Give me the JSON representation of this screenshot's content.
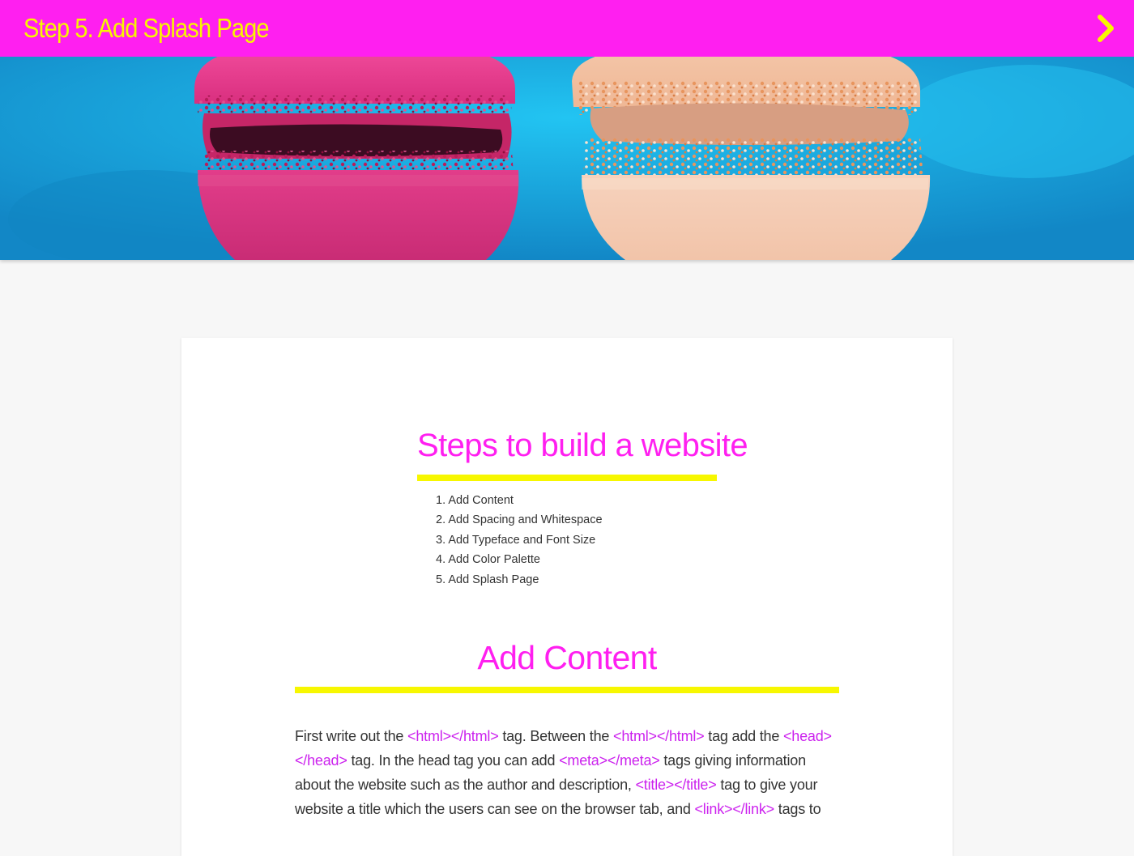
{
  "header": {
    "title": "Step 5. Add Splash Page",
    "next_icon": "chevron-right-icon",
    "colors": {
      "bar": "#ff1ff0",
      "title": "#f7f700"
    }
  },
  "hero": {
    "image": "two macarons (pink and cream) against a blue background"
  },
  "steps": {
    "heading": "Steps to build a website",
    "items": [
      {
        "num": "1.",
        "label": "Add Content"
      },
      {
        "num": "2.",
        "label": "Add Spacing and Whitespace"
      },
      {
        "num": "3.",
        "label": "Add Typeface and Font Size"
      },
      {
        "num": "4.",
        "label": "Add Color Palette"
      },
      {
        "num": "5.",
        "label": "Add Splash Page"
      }
    ]
  },
  "section": {
    "heading": "Add Content",
    "paragraph": [
      {
        "t": "First write out the ",
        "code": false
      },
      {
        "t": "<html></html>",
        "code": true
      },
      {
        "t": " tag. Between the ",
        "code": false
      },
      {
        "t": "<html></html>",
        "code": true
      },
      {
        "t": " tag add the ",
        "code": false
      },
      {
        "t": "<head></head>",
        "code": true
      },
      {
        "t": " tag. In the head tag you can add ",
        "code": false
      },
      {
        "t": "<meta></meta>",
        "code": true
      },
      {
        "t": " tags giving information about the website such as the author and description, ",
        "code": false
      },
      {
        "t": "<title></title>",
        "code": true
      },
      {
        "t": " tag to give your website a title which the users can see on the browser tab, and ",
        "code": false
      },
      {
        "t": "<link></link>",
        "code": true
      },
      {
        "t": " tags to",
        "code": false
      }
    ]
  },
  "colors": {
    "accent_pink": "#ff1ff0",
    "accent_yellow": "#f7f700",
    "code_purple": "#cc22ee",
    "page_bg": "#f7f7f7"
  }
}
